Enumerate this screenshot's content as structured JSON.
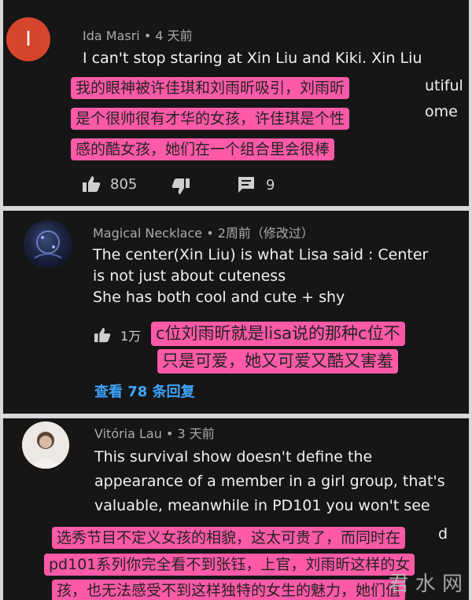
{
  "comments": [
    {
      "avatar_letter": "I",
      "avatar_color": "#d5452b",
      "author": "Ida Masri",
      "time": "• 4 天前",
      "body_lines": [
        "I can't stop staring at Xin Liu and Kiki. Xin Liu"
      ],
      "partial_right": [
        "utiful",
        "ome"
      ],
      "translation": [
        "我的眼神被许佳琪和刘雨昕吸引，刘雨昕",
        "是个很帅很有才华的女孩，许佳琪是个性",
        "感的酷女孩，她们在一个组合里会很棒"
      ],
      "likes": "805",
      "replies_count": "9"
    },
    {
      "author": "Magical Necklace",
      "time": "• 2周前（修改过）",
      "body_lines": [
        "The center(Xin Liu) is what Lisa said : Center",
        "is not just about cuteness",
        "She has both cool and cute + shy"
      ],
      "likes": "1万",
      "translation": [
        "c位刘雨昕就是lisa说的那种c位不",
        "只是可爱，她又可爱又酷又害羞"
      ],
      "view_replies": "查看 78 条回复"
    },
    {
      "author": "Vitória Lau",
      "time": "• 3 天前",
      "body_lines": [
        "This survival show doesn't define the",
        "appearance of a member in a girl group, that's",
        "valuable, meanwhile in PD101 you won't see"
      ],
      "partial_right": [
        "d"
      ],
      "translation": [
        "选秀节目不定义女孩的相貌，这太可贵了，而同时在",
        "pd101系列你完全看不到张钰，上官，刘雨昕这样的女",
        "孩，也无法感受不到这样独特的女生的魅力，她们值"
      ]
    }
  ],
  "watermark": "君 水 网"
}
